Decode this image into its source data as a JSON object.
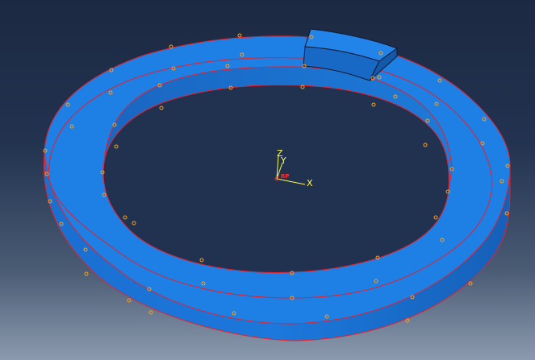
{
  "viewport": {
    "background_top": "#1c2942",
    "background_bottom": "#8b9aae"
  },
  "model": {
    "part_color": "#1e7fe0",
    "part_side_color": "#176bc4",
    "part_top_light": "#2a8cf0",
    "edge_color": "#e8202a",
    "node_color": "#ffa018"
  },
  "triad": {
    "z_label": "Z",
    "y_label": "Y",
    "x_label": "X",
    "rp_label": "RP",
    "axis_color": "#ffff40",
    "rp_color": "#ff3030"
  }
}
